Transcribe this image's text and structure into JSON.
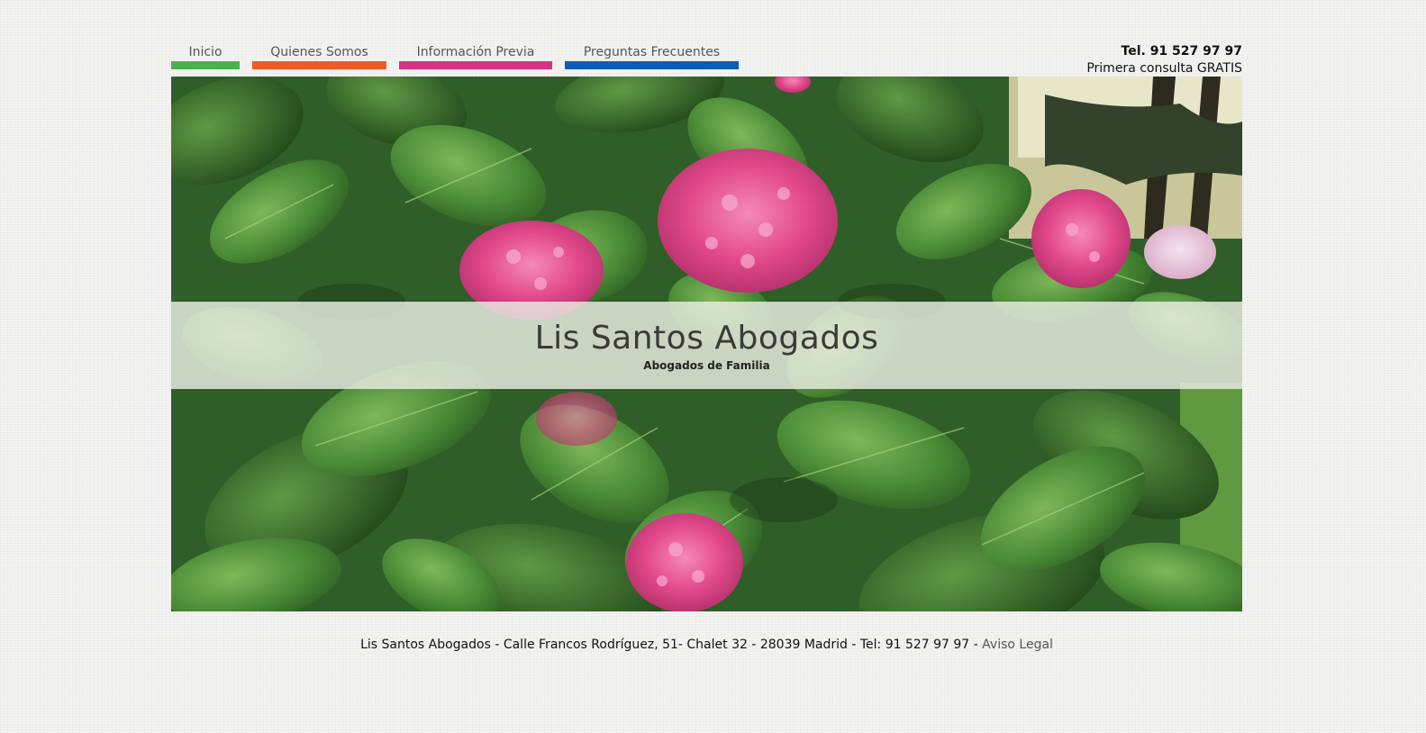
{
  "nav": {
    "items": [
      {
        "label": "Inicio",
        "color": "#4caf50"
      },
      {
        "label": "Quienes Somos",
        "color": "#f05a28"
      },
      {
        "label": "Información Previa",
        "color": "#d63384"
      },
      {
        "label": "Preguntas Frecuentes",
        "color": "#0b5db5"
      }
    ]
  },
  "contact": {
    "phone": "Tel. 91 527 97 97",
    "offer": "Primera consulta GRATIS"
  },
  "hero": {
    "title": "Lis Santos Abogados",
    "subtitle": "Abogados de Familia"
  },
  "footer": {
    "text": "Lis Santos Abogados - Calle Francos Rodríguez, 51- Chalet 32 - 28039 Madrid - Tel: 91 527 97 97 - ",
    "link_label": "Aviso Legal"
  },
  "colors": {
    "background": "#f3f3f1",
    "band": "#eceee4",
    "leaf": "#3f7a34",
    "flower": "#e64a8c"
  }
}
